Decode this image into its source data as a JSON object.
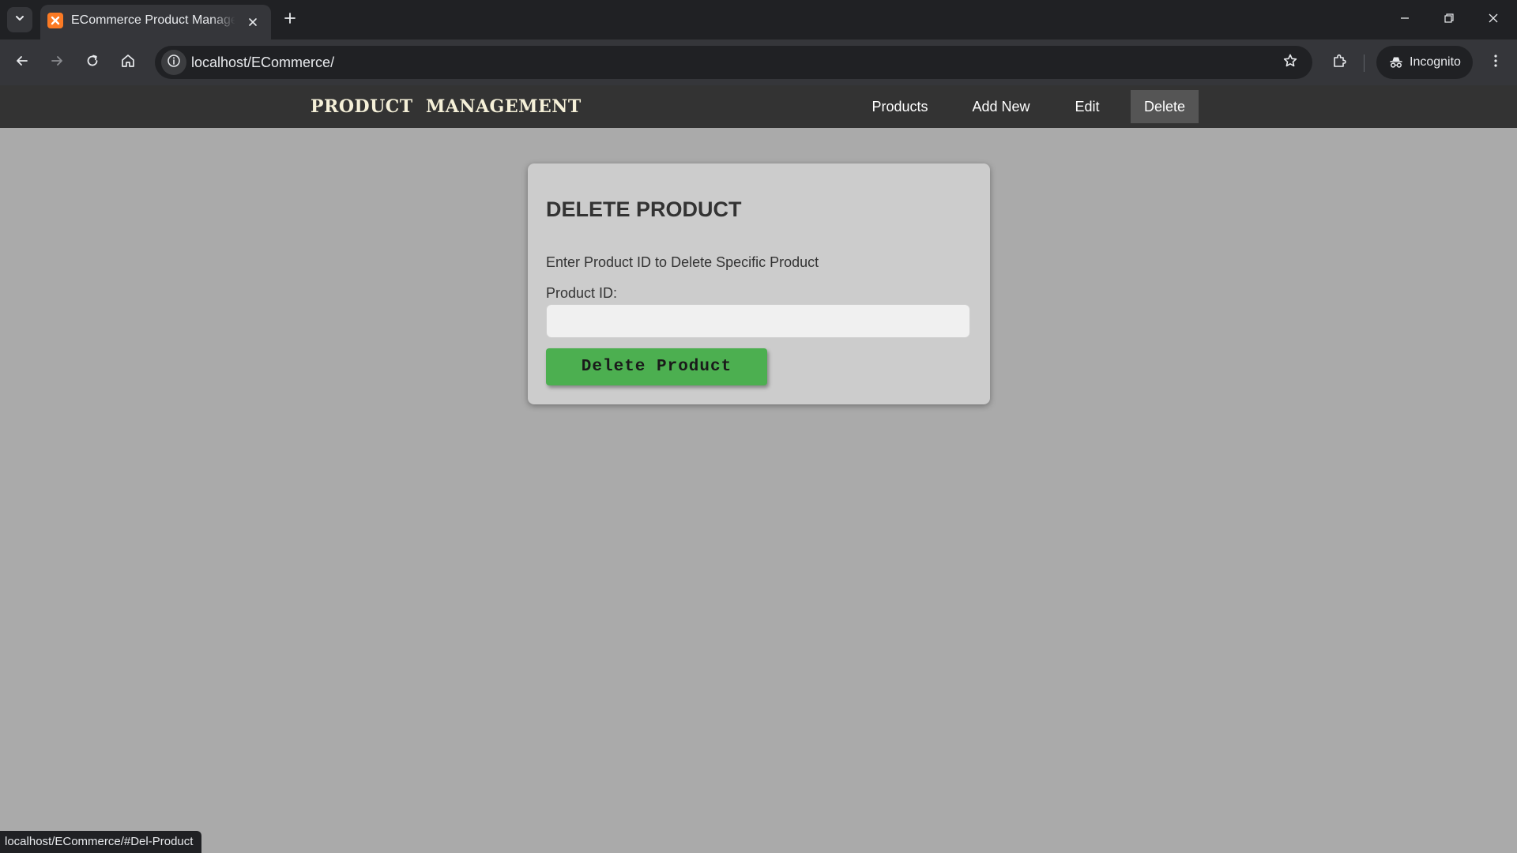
{
  "browser": {
    "tab": {
      "title": "ECommerce Product Management",
      "favicon": "xampp-icon"
    },
    "address_bar": {
      "url": "localhost/ECommerce/"
    },
    "profile": {
      "label": "Incognito"
    },
    "status_url": "localhost/ECommerce/#Del-Product"
  },
  "header": {
    "brand": "PRODUCT  MANAGEMENT",
    "nav": [
      {
        "label": "Products",
        "active": false
      },
      {
        "label": "Add New",
        "active": false
      },
      {
        "label": "Edit",
        "active": false
      },
      {
        "label": "Delete",
        "active": true
      }
    ]
  },
  "delete_form": {
    "title": "DELETE PRODUCT",
    "description": "Enter Product ID to Delete Specific Product",
    "id_label": "Product ID:",
    "id_value": "",
    "submit_label": "Delete Product"
  },
  "colors": {
    "page_background": "#aaaaaa",
    "header_background": "#333333",
    "active_nav": "#555555",
    "card_background": "#cccccc",
    "button_green": "#4caf50"
  }
}
